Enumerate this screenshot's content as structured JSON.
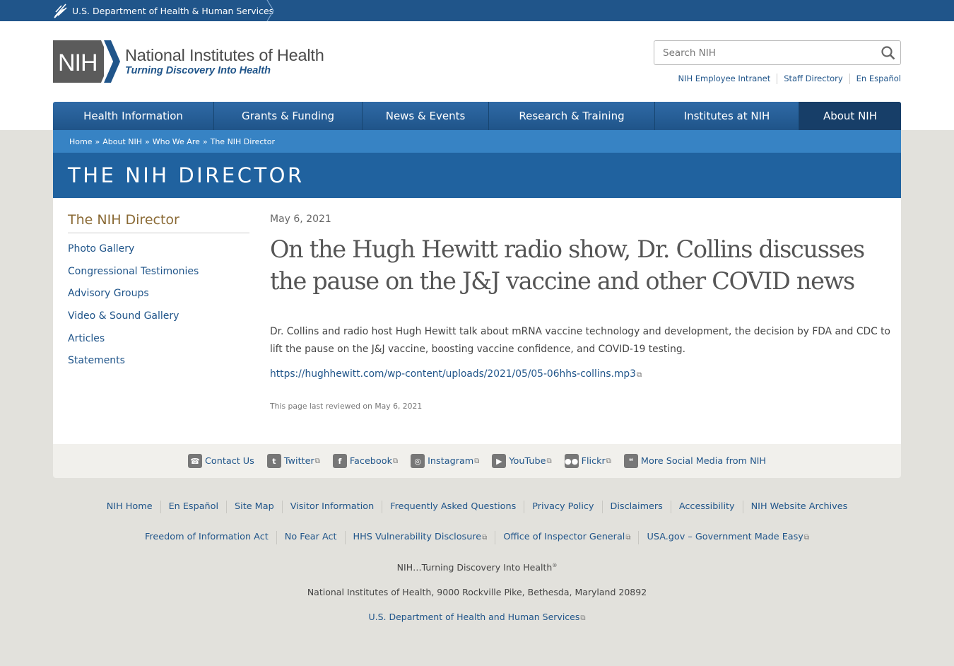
{
  "hhs": {
    "label": "U.S. Department of Health & Human Services",
    "icon": "hhs-eagle-icon"
  },
  "header": {
    "logo_mark": "NIH",
    "logo_title": "National Institutes of Health",
    "logo_tagline": "Turning Discovery Into Health",
    "search_placeholder": "Search NIH",
    "util_links": [
      "NIH Employee Intranet",
      "Staff Directory",
      "En Español"
    ]
  },
  "nav": {
    "items": [
      "Health Information",
      "Grants & Funding",
      "News & Events",
      "Research & Training",
      "Institutes at NIH",
      "About NIH"
    ],
    "active": "About NIH"
  },
  "breadcrumb": {
    "items": [
      "Home",
      "About NIH",
      "Who We Are",
      "The NIH Director"
    ],
    "separator": "»"
  },
  "banner": {
    "title": "THE NIH DIRECTOR"
  },
  "sidebar": {
    "title": "The NIH Director",
    "items": [
      "Photo Gallery",
      "Congressional Testimonies",
      "Advisory Groups",
      "Video & Sound Gallery",
      "Articles",
      "Statements"
    ]
  },
  "article": {
    "date": "May 6, 2021",
    "headline": "On the Hugh Hewitt radio show, Dr. Collins discusses the pause on the J&J vaccine and other COVID news",
    "summary": "Dr. Collins and radio host Hugh Hewitt talk about mRNA vaccine technology and development, the decision by FDA and CDC to lift the pause on the J&J vaccine, boosting vaccine confidence, and COVID-19 testing.",
    "audio_link": "https://hughhewitt.com/wp-content/uploads/2021/05/05-06hhs-collins.mp3",
    "reviewed": "This page last reviewed on May 6, 2021"
  },
  "social": {
    "items": [
      {
        "label": "Contact Us",
        "icon": "phone-icon"
      },
      {
        "label": "Twitter",
        "icon": "twitter-icon"
      },
      {
        "label": "Facebook",
        "icon": "facebook-icon"
      },
      {
        "label": "Instagram",
        "icon": "instagram-icon"
      },
      {
        "label": "YouTube",
        "icon": "youtube-icon"
      },
      {
        "label": "Flickr",
        "icon": "flickr-icon"
      },
      {
        "label": "More Social Media from NIH",
        "icon": "chat-bubbles-icon"
      }
    ]
  },
  "footer": {
    "row1": [
      "NIH Home",
      "En Español",
      "Site Map",
      "Visitor Information",
      "Frequently Asked Questions",
      "Privacy Policy",
      "Disclaimers",
      "Accessibility",
      "NIH Website Archives"
    ],
    "row2": [
      "Freedom of Information Act",
      "No Fear Act",
      "HHS Vulnerability Disclosure",
      "Office of Inspector General",
      "USA.gov – Government Made Easy"
    ],
    "tagline": "NIH…Turning Discovery Into Health",
    "tagline_mark": "®",
    "address": "National Institutes of Health, 9000 Rockville Pike, Bethesda, Maryland 20892",
    "hhs_link": "U.S. Department of Health and Human Services"
  },
  "colors": {
    "brand_blue": "#20558a",
    "nav_active": "#173e68",
    "breadcrumb": "#3783c4",
    "sidebar_title": "#8a6a35"
  }
}
